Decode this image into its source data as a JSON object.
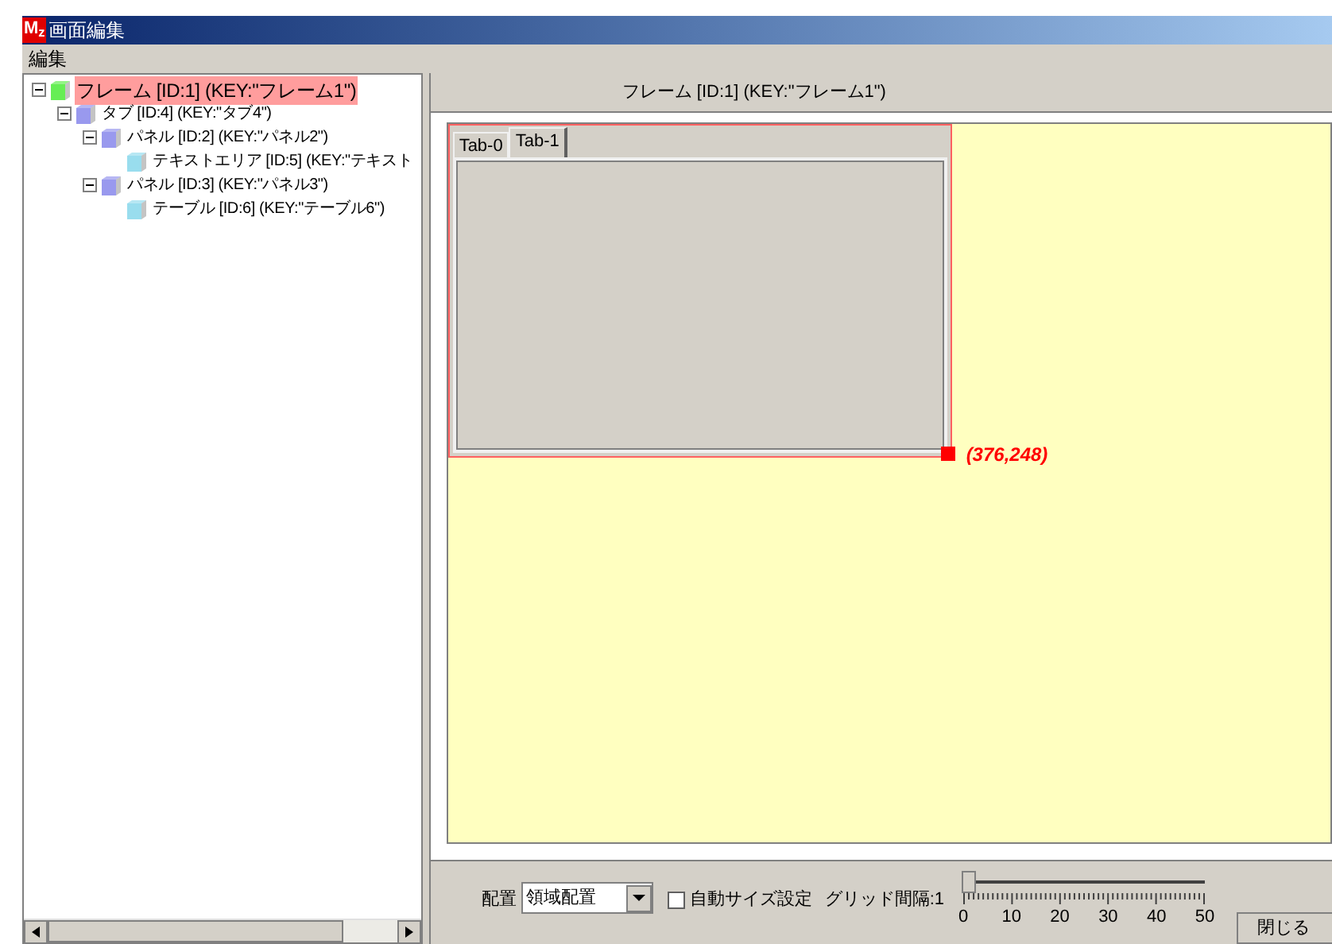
{
  "window": {
    "logo": "M$_{z}$",
    "title": "画面編集"
  },
  "menu": [
    "編集"
  ],
  "tree": [
    {
      "label": "フレーム [ID:1] (KEY:\"フレーム1\")",
      "color": "#66ee55",
      "selected": true,
      "expanded": true,
      "children": [
        {
          "label": "タブ [ID:4] (KEY:\"タブ4\")",
          "color": "#9999ee",
          "selected": false,
          "expanded": true,
          "children": [
            {
              "label": "パネル [ID:2] (KEY:\"パネル2\")",
              "color": "#9999ee",
              "selected": false,
              "expanded": true,
              "children": [
                {
                  "label": "テキストエリア [ID:5] (KEY:\"テキスト",
                  "color": "#99ddee",
                  "selected": false
                }
              ]
            },
            {
              "label": "パネル [ID:3] (KEY:\"パネル3\")",
              "color": "#9999ee",
              "selected": false,
              "expanded": true,
              "children": [
                {
                  "label": "テーブル [ID:6] (KEY:\"テーブル6\")",
                  "color": "#99ddee",
                  "selected": false
                }
              ]
            }
          ]
        }
      ]
    }
  ],
  "editor": {
    "header": "フレーム [ID:1] (KEY:\"フレーム1\")",
    "tabs": [
      {
        "label": "Tab-0",
        "selected": false
      },
      {
        "label": "Tab-1",
        "selected": true
      }
    ],
    "coordinates": "(376,248)"
  },
  "bottom": {
    "layout_label": "配置",
    "layout_value": "領域配置",
    "auto_size": {
      "label": "自動サイズ設定",
      "checked": false
    },
    "grid_label": "グリッド間隔:1",
    "slider": {
      "level": 0.02,
      "ticks": [
        "0",
        "10",
        "20",
        "30",
        "40",
        "50"
      ]
    },
    "close": "閉じる"
  }
}
